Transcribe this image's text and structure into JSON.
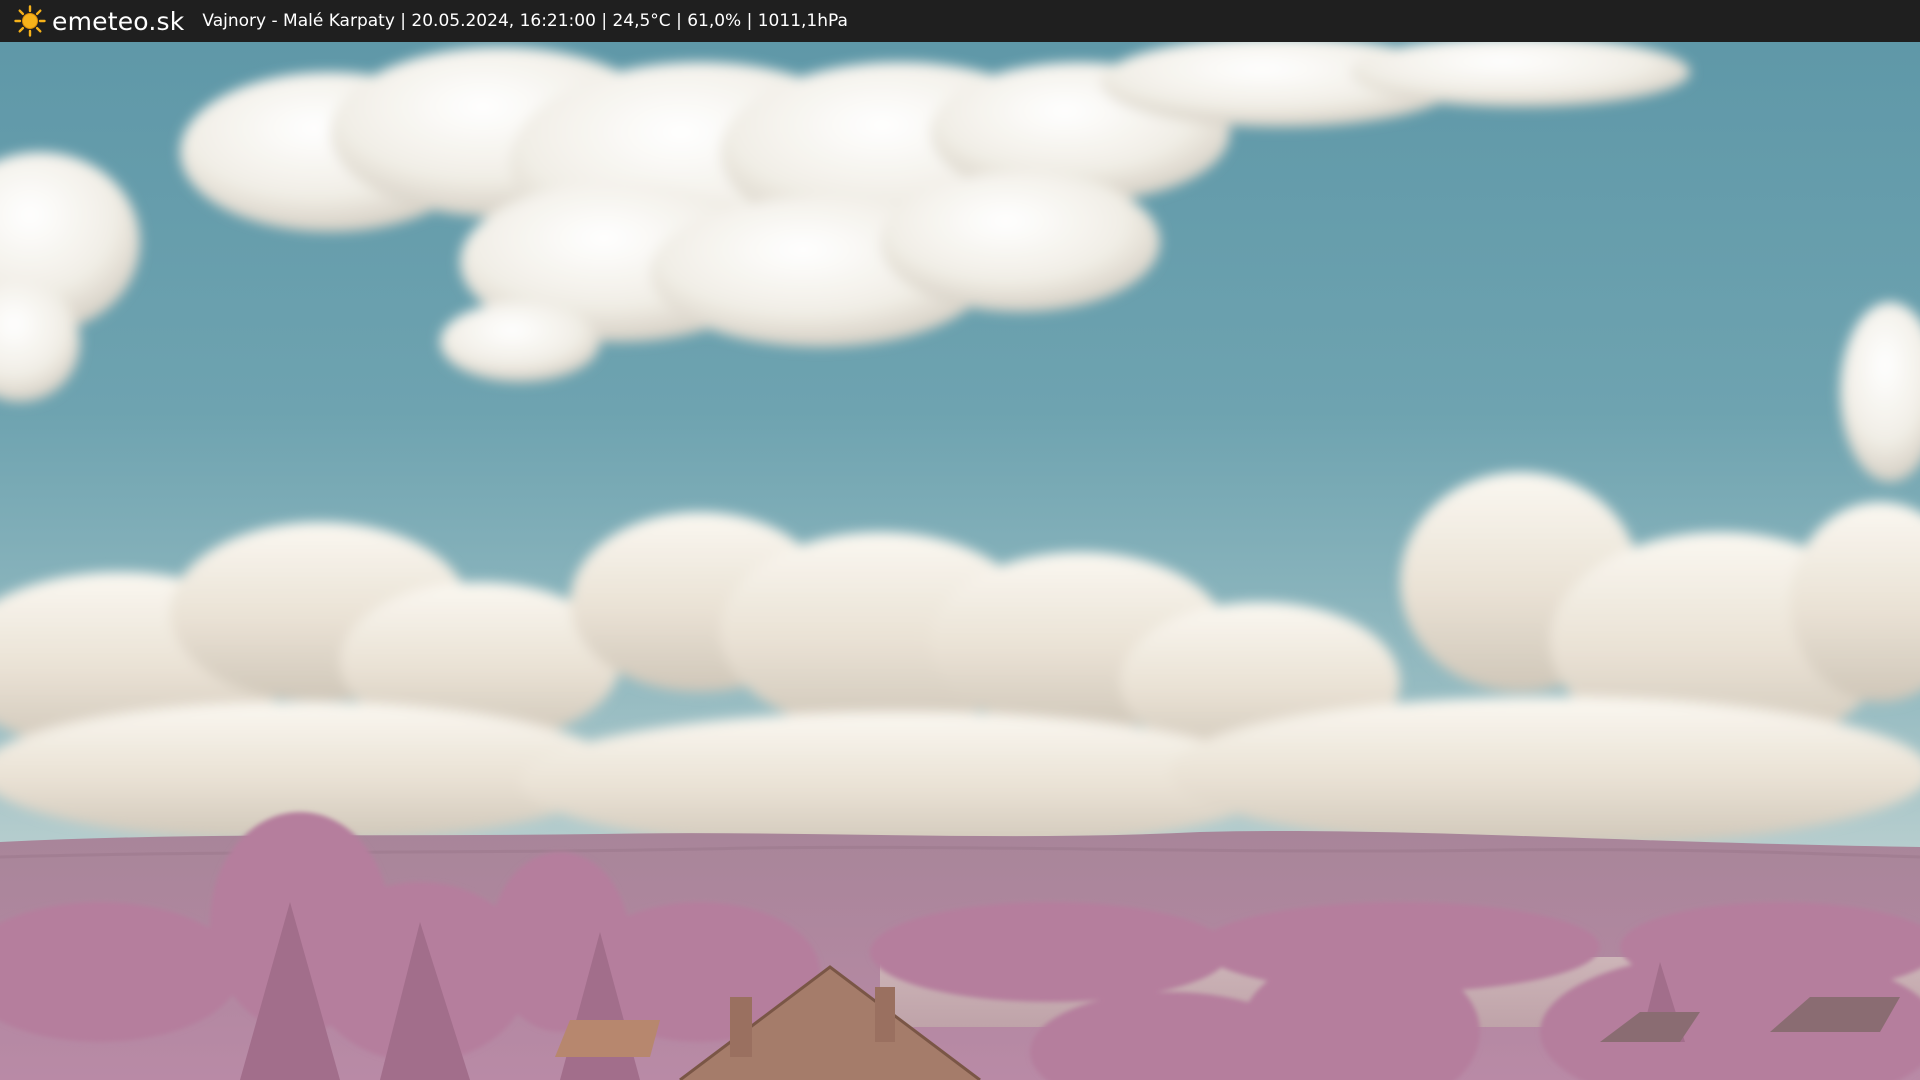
{
  "header": {
    "logo_text": "emeteo.sk",
    "station_info": "Vajnory - Malé Karpaty | 20.05.2024, 16:21:00 | 24,5°C | 61,0% | 1011,1hPa"
  },
  "icons": {
    "logo": "sun-icon"
  },
  "colors": {
    "bar_background": "#1f1f1f",
    "bar_text": "#ffffff",
    "sun": "#f6b21a",
    "sky": "#6c9fac",
    "foliage": "#b9809f"
  }
}
